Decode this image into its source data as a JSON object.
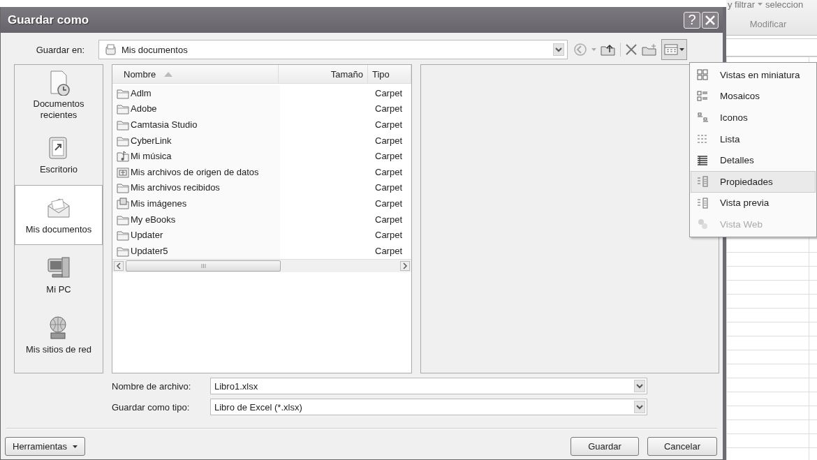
{
  "window": {
    "title": "Guardar como",
    "help_button": "?"
  },
  "save_in": {
    "label": "Guardar en:",
    "value": "Mis documentos"
  },
  "places": [
    {
      "label": "Documentos recientes",
      "kind": "recent",
      "selected": false
    },
    {
      "label": "Escritorio",
      "kind": "desktop",
      "selected": false
    },
    {
      "label": "Mis documentos",
      "kind": "documents",
      "selected": true
    },
    {
      "label": "Mi PC",
      "kind": "computer",
      "selected": false
    },
    {
      "label": "Mis sitios de red",
      "kind": "network",
      "selected": false
    }
  ],
  "file_list": {
    "columns": [
      "Nombre",
      "Tamaño",
      "Tipo"
    ],
    "rows": [
      {
        "name": "Adlm",
        "type": "Carpet",
        "kind": "folder"
      },
      {
        "name": "Adobe",
        "type": "Carpet",
        "kind": "folder"
      },
      {
        "name": "Camtasia Studio",
        "type": "Carpet",
        "kind": "folder"
      },
      {
        "name": "CyberLink",
        "type": "Carpet",
        "kind": "folder"
      },
      {
        "name": "Mi música",
        "type": "Carpet",
        "kind": "music"
      },
      {
        "name": "Mis archivos de origen de datos",
        "type": "Carpet",
        "kind": "data"
      },
      {
        "name": "Mis archivos recibidos",
        "type": "Carpet",
        "kind": "folder"
      },
      {
        "name": "Mis imágenes",
        "type": "Carpet",
        "kind": "pictures"
      },
      {
        "name": "My eBooks",
        "type": "Carpet",
        "kind": "folder"
      },
      {
        "name": "Updater",
        "type": "Carpet",
        "kind": "folder"
      },
      {
        "name": "Updater5",
        "type": "Carpet",
        "kind": "folder"
      }
    ]
  },
  "view_menu": {
    "items": [
      {
        "label": "Vistas en miniatura",
        "kind": "thumbnails",
        "selected": false,
        "disabled": false
      },
      {
        "label": "Mosaicos",
        "kind": "tiles",
        "selected": false,
        "disabled": false
      },
      {
        "label": "Iconos",
        "kind": "icons",
        "selected": false,
        "disabled": false
      },
      {
        "label": "Lista",
        "kind": "list",
        "selected": false,
        "disabled": false
      },
      {
        "label": "Detalles",
        "kind": "details",
        "selected": false,
        "disabled": false
      },
      {
        "label": "Propiedades",
        "kind": "properties",
        "selected": true,
        "disabled": false
      },
      {
        "label": "Vista previa",
        "kind": "preview",
        "selected": false,
        "disabled": false
      },
      {
        "label": "Vista Web",
        "kind": "web",
        "selected": false,
        "disabled": true
      }
    ]
  },
  "file_name": {
    "label": "Nombre de archivo:",
    "value": "Libro1.xlsx"
  },
  "file_type": {
    "label": "Guardar como tipo:",
    "value": "Libro de Excel (*.xlsx)"
  },
  "buttons": {
    "tools": "Herramientas",
    "save": "Guardar",
    "cancel": "Cancelar"
  },
  "background_app": {
    "ribbon_text_1": "y filtrar",
    "ribbon_text_2": "seleccion",
    "group_label": "Modificar"
  }
}
